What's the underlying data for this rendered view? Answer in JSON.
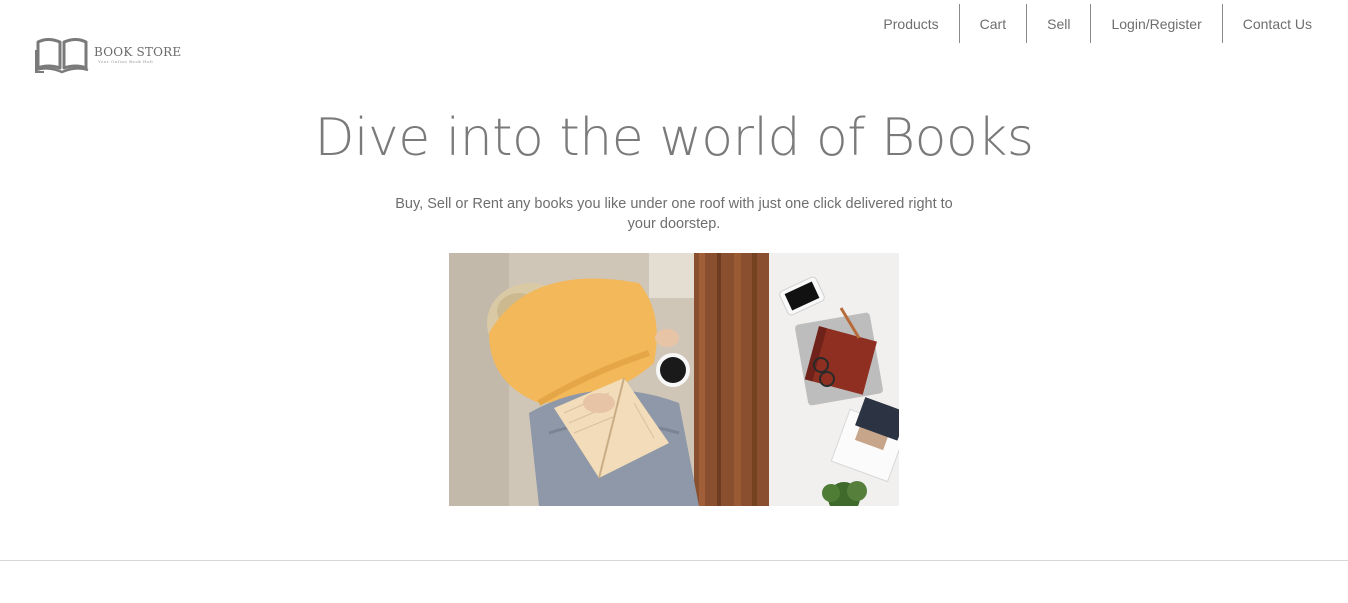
{
  "logo": {
    "title": "BOOK STORE",
    "tagline": "Your Online Book Hub",
    "icon": "open-book-icon"
  },
  "nav": {
    "items": [
      {
        "label": "Products"
      },
      {
        "label": "Cart"
      },
      {
        "label": "Sell"
      },
      {
        "label": "Login/Register"
      },
      {
        "label": "Contact Us"
      }
    ]
  },
  "hero": {
    "title": "Dive into the world of Books",
    "subtitle": "Buy, Sell or Rent any books you like under one roof with just one click delivered right to your doorstep."
  },
  "colors": {
    "text": "#707070",
    "divider": "#d8d8d8"
  }
}
